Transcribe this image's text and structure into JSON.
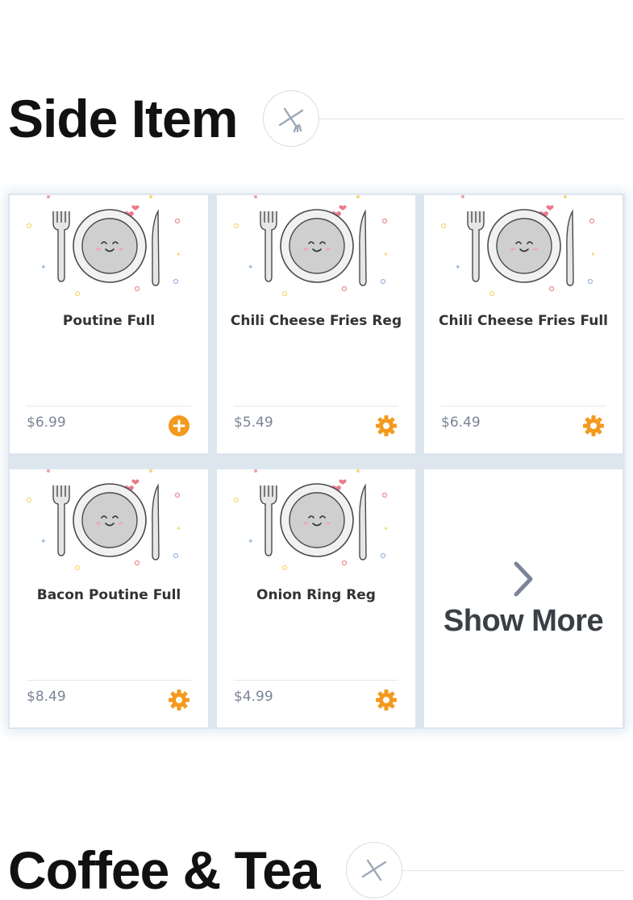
{
  "sections": [
    {
      "title": "Side Item",
      "icon": "fork-knife-icon"
    },
    {
      "title": "Coffee & Tea",
      "icon": "fork-knife-icon"
    }
  ],
  "items": [
    {
      "name": "Poutine Full",
      "price": "$6.99",
      "action": "add-icon"
    },
    {
      "name": "Chili Cheese Fries Reg",
      "price": "$5.49",
      "action": "customize-gear-icon"
    },
    {
      "name": "Chili Cheese Fries Full",
      "price": "$6.49",
      "action": "customize-gear-icon"
    },
    {
      "name": "Bacon Poutine Full",
      "price": "$8.49",
      "action": "customize-gear-icon"
    },
    {
      "name": "Onion Ring Reg",
      "price": "$4.99",
      "action": "customize-gear-icon"
    }
  ],
  "show_more": {
    "label": "Show More",
    "icon": "chevron-right-icon"
  },
  "colors": {
    "accent": "#f39a1e",
    "price": "#7b8597",
    "chevron": "#7b8597"
  }
}
